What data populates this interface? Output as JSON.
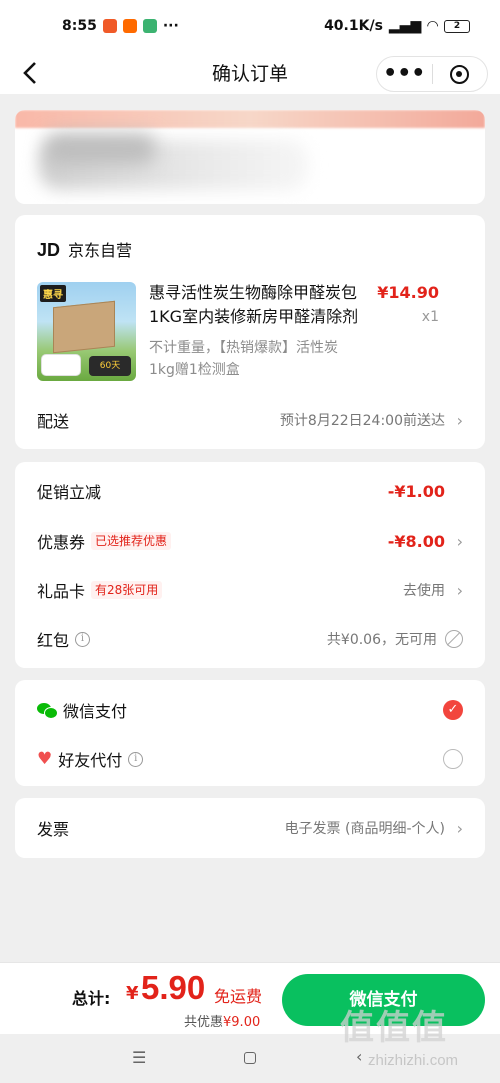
{
  "status_bar": {
    "time": "8:55",
    "network_speed": "40.1K/s",
    "battery": "2",
    "more": "···",
    "app_icon_colors": [
      "#f05a28",
      "#ff6a00",
      "#3cb371"
    ]
  },
  "nav": {
    "title": "确认订单",
    "back_icon": "chevron-left-icon",
    "more_label": "•••"
  },
  "address": {
    "blurred": true
  },
  "shop": {
    "logo": "JD",
    "name": "京东自营"
  },
  "product": {
    "thumb_tag": "惠寻",
    "thumb_badge": "60天",
    "title": "惠寻活性炭生物酶除甲醛炭包1KG室内装修新房甲醛清除剂",
    "price": "¥14.90",
    "quantity": "x1",
    "spec": "不计重量，【热销爆款】活性炭1kg赠1检测盒"
  },
  "delivery": {
    "label": "配送",
    "value": "预计8月22日24:00前送达"
  },
  "discounts": {
    "promo": {
      "label": "促销立减",
      "value": "-¥1.00"
    },
    "coupon": {
      "label": "优惠券",
      "tag": "已选推荐优惠",
      "value": "-¥8.00"
    },
    "giftcard": {
      "label": "礼品卡",
      "tag": "有28张可用",
      "value": "去使用"
    },
    "redpacket": {
      "label": "红包",
      "value": "共¥0.06，无可用"
    }
  },
  "payment": {
    "wechat": {
      "label": "微信支付",
      "selected": true
    },
    "friend": {
      "label": "好友代付",
      "selected": false
    }
  },
  "invoice": {
    "label": "发票",
    "value": "电子发票 (商品明细-个人)"
  },
  "footer": {
    "total_label": "总计:",
    "currency": "¥",
    "total_amount": "5.90",
    "free_shipping": "免运费",
    "saved_prefix": "共优惠",
    "saved_amount": "¥9.00",
    "pay_button": "微信支付"
  },
  "watermark": {
    "text": "值值值",
    "url": "zhizhizhi.com"
  },
  "colors": {
    "accent_red": "#e2231a",
    "wechat_green": "#09c05f",
    "background": "#efefef"
  }
}
